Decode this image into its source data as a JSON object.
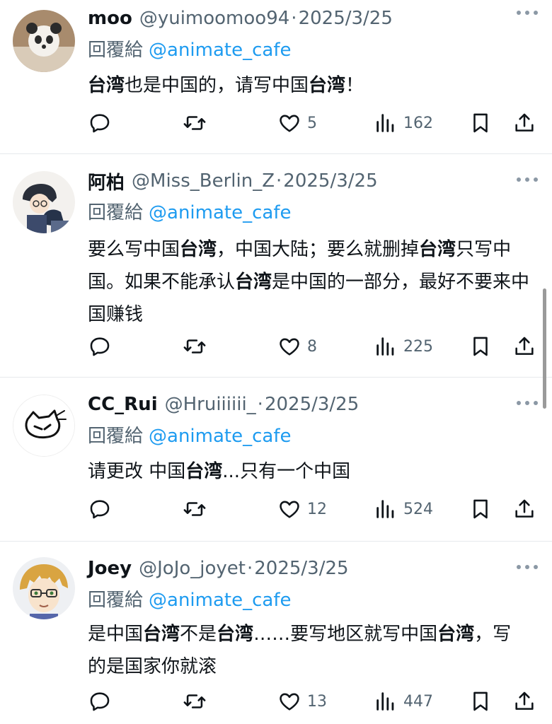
{
  "colors": {
    "link": "#1d9bf0",
    "secondary": "#536471",
    "text": "#0f1419",
    "divider": "#e6e9ec"
  },
  "reply_prefix": "回覆給",
  "tweets": [
    {
      "name": "moo",
      "handle": "@yuimoomoo94",
      "separator": "·",
      "date": "2025/3/25",
      "reply_to": "@animate_cafe",
      "avatar_icon": "panda-figure-avatar",
      "text_segments": [
        {
          "t": "台湾",
          "b": true
        },
        {
          "t": "也是中国的，请写中国",
          "b": false
        },
        {
          "t": "台湾",
          "b": true
        },
        {
          "t": "！",
          "b": false
        }
      ],
      "likes": "5",
      "views": "162"
    },
    {
      "name": "阿柏",
      "handle": "@Miss_Berlin_Z",
      "separator": "·",
      "date": "2025/3/25",
      "reply_to": "@animate_cafe",
      "avatar_icon": "anime-characters-avatar",
      "text_segments": [
        {
          "t": "要么写中国",
          "b": false
        },
        {
          "t": "台湾",
          "b": true
        },
        {
          "t": "，中国大陆；要么就删掉",
          "b": false
        },
        {
          "t": "台湾",
          "b": true
        },
        {
          "t": "只写中国。如果不能承认",
          "b": false
        },
        {
          "t": "台湾",
          "b": true
        },
        {
          "t": "是中国的一部分，最好不要来中国赚钱",
          "b": false
        }
      ],
      "likes": "8",
      "views": "225"
    },
    {
      "name": "CC_Rui",
      "handle": "@Hruiiiiii_",
      "separator": "·",
      "date": "2025/3/25",
      "reply_to": "@animate_cafe",
      "avatar_icon": "cat-sketch-avatar",
      "text_segments": [
        {
          "t": "请更改 中国",
          "b": false
        },
        {
          "t": "台湾",
          "b": true
        },
        {
          "t": "...只有一个中国",
          "b": false
        }
      ],
      "likes": "12",
      "views": "524"
    },
    {
      "name": "Joey",
      "handle": "@JoJo_joyet",
      "separator": "·",
      "date": "2025/3/25",
      "reply_to": "@animate_cafe",
      "avatar_icon": "anime-boy-glasses-avatar",
      "text_segments": [
        {
          "t": "是中国",
          "b": false
        },
        {
          "t": "台湾",
          "b": true
        },
        {
          "t": "不是",
          "b": false
        },
        {
          "t": "台湾",
          "b": true
        },
        {
          "t": "……要写地区就写中国",
          "b": false
        },
        {
          "t": "台湾",
          "b": true
        },
        {
          "t": "，写的是国家你就滚",
          "b": false
        }
      ],
      "likes": "13",
      "views": "447"
    }
  ]
}
